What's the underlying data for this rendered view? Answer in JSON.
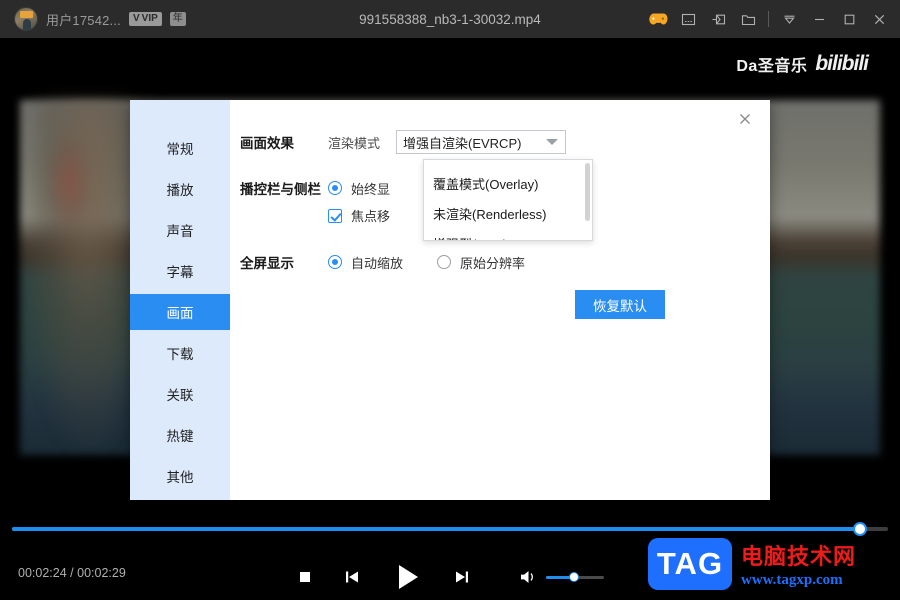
{
  "titlebar": {
    "user_name": "用户17542...",
    "vip_badge": "VIP",
    "year_badge": "年",
    "file_title": "991558388_nb3-1-30032.mp4",
    "buttons": {
      "game": "🎮",
      "screenshot": "screenshot",
      "cast": "cast",
      "folder": "folder",
      "menu": "menu",
      "minimize": "minimize",
      "maximize": "maximize",
      "close": "close"
    }
  },
  "overlay_logo": {
    "brand": "Da圣音乐",
    "site": "bilibili"
  },
  "dialog": {
    "close_label": "✕",
    "sidebar": [
      {
        "label": "常规",
        "active": false
      },
      {
        "label": "播放",
        "active": false
      },
      {
        "label": "声音",
        "active": false
      },
      {
        "label": "字幕",
        "active": false
      },
      {
        "label": "画面",
        "active": true
      },
      {
        "label": "下载",
        "active": false
      },
      {
        "label": "关联",
        "active": false
      },
      {
        "label": "热键",
        "active": false
      },
      {
        "label": "其他",
        "active": false
      }
    ],
    "rows": {
      "picture_effect_label": "画面效果",
      "render_mode_label": "渲染模式",
      "render_mode_value": "增强自渲染(EVRCP)",
      "control_bar_label": "播控栏与侧栏",
      "option_always_show": "始终显",
      "option_focus_move": "焦点移",
      "fullscreen_label": "全屏显示",
      "fullscreen_auto": "自动缩放",
      "fullscreen_native": "原始分辨率",
      "restore_default": "恢复默认"
    },
    "dropdown_options": [
      "覆盖模式(Overlay)",
      "未渲染(Renderless)",
      "增强型(EVR)"
    ]
  },
  "player": {
    "current_time": "00:02:24",
    "separator": "/",
    "total_time": "00:02:29",
    "progress_percent": 97,
    "volume_percent": 48,
    "controls": {
      "stop": "stop-button",
      "previous": "previous-button",
      "play": "play-button",
      "next": "next-button",
      "volume": "volume-button"
    }
  },
  "watermark": {
    "tag": "TAG",
    "chinese": "电脑技术网",
    "url": "www.tagxp.com"
  },
  "colors": {
    "accent_blue": "#2a8df2",
    "progress_blue": "#1f8ef1",
    "sidebar_bg": "#ddeafc",
    "titlebar_bg": "#2b2b2b",
    "watermark_red": "#ef1b1b",
    "watermark_blue": "#1f6fff"
  }
}
